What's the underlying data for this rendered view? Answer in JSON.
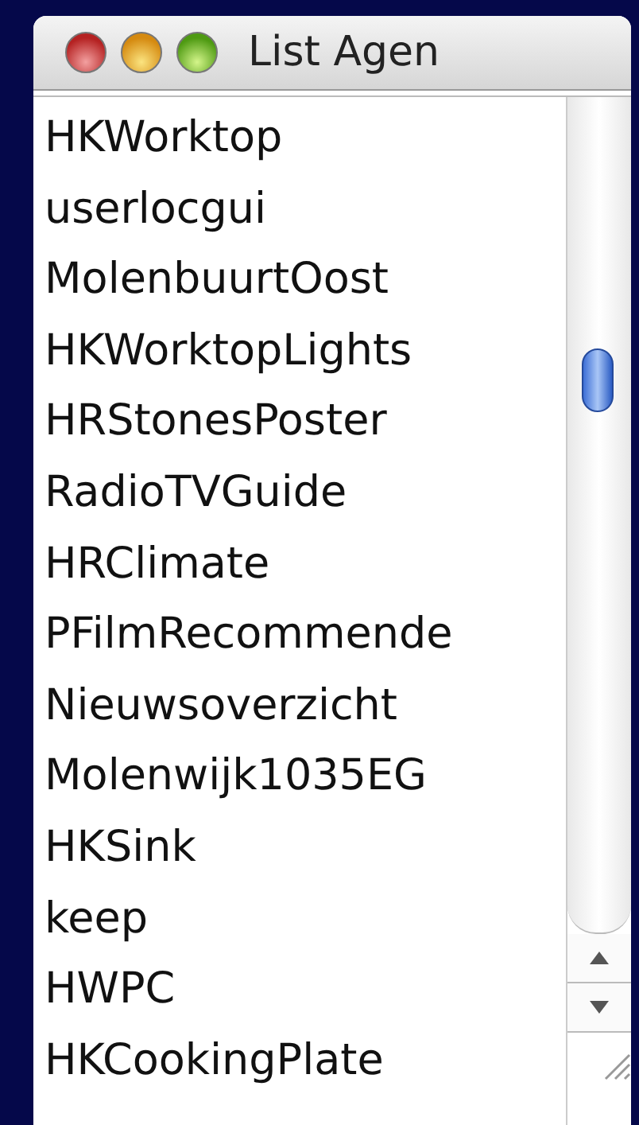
{
  "window": {
    "title": "List Agen"
  },
  "list": {
    "items": [
      {
        "label": "HKWorktop"
      },
      {
        "label": "userlocgui"
      },
      {
        "label": "MolenbuurtOost"
      },
      {
        "label": "HKWorktopLights"
      },
      {
        "label": "HRStonesPoster"
      },
      {
        "label": "RadioTVGuide"
      },
      {
        "label": "HRClimate"
      },
      {
        "label": "PFilmRecommende"
      },
      {
        "label": "Nieuwsoverzicht"
      },
      {
        "label": "Molenwijk1035EG"
      },
      {
        "label": "HKSink"
      },
      {
        "label": "keep"
      },
      {
        "label": "HWPC"
      },
      {
        "label": "HKCookingPlate"
      }
    ]
  }
}
